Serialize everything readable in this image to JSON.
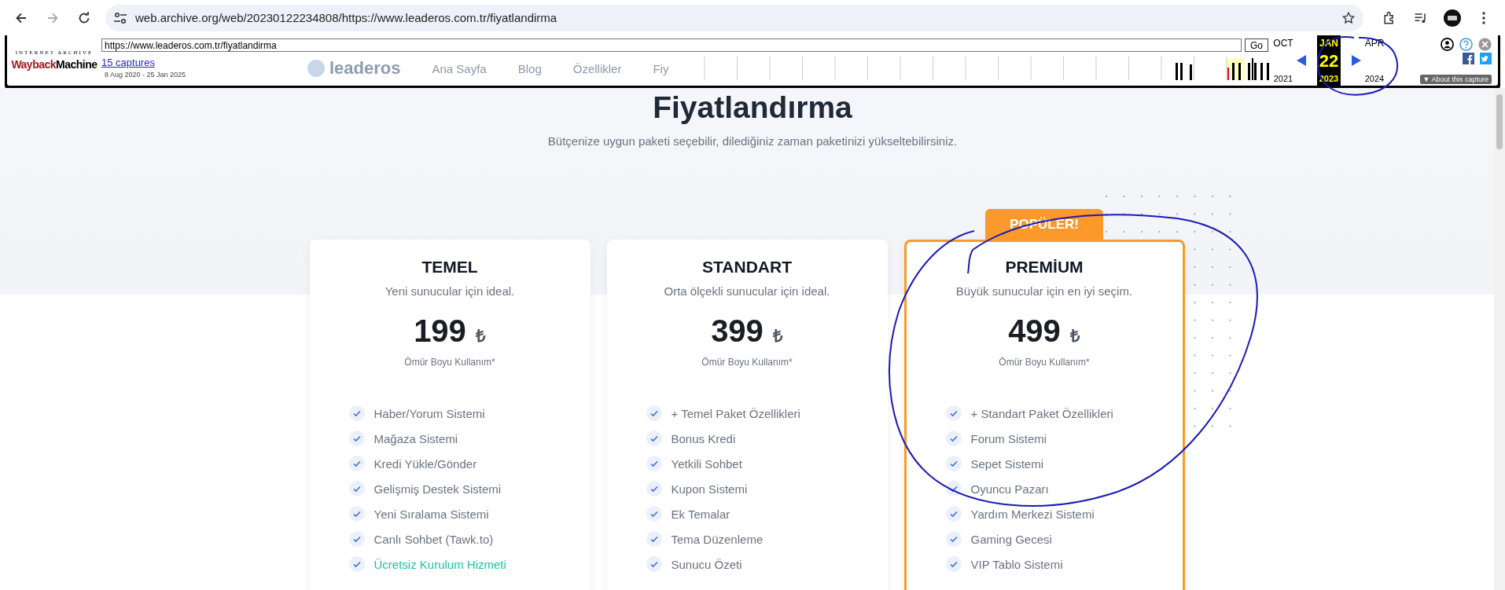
{
  "browser": {
    "url": "web.archive.org/web/20230122234808/https://www.leaderos.com.tr/fiyatlandirma",
    "forward_disabled": true
  },
  "wayback": {
    "logo_top": "INTERNET ARCHIVE",
    "logo_wayback": "Wayback",
    "logo_machine": "Machine",
    "url": "https://www.leaderos.com.tr/fiyatlandirma",
    "go": "Go",
    "captures": "15 captures",
    "date_range": "8 Aug 2020 - 25 Jan 2025",
    "months": [
      {
        "month": "OCT",
        "year": "2021",
        "selected": false
      },
      {
        "month": "JAN",
        "day": "22",
        "year": "2023",
        "selected": true
      },
      {
        "month": "APR",
        "year": "2024",
        "selected": false
      }
    ],
    "about_caret": "▼",
    "about": "About this capture"
  },
  "site_behind": {
    "logo": "leaderos",
    "nav": [
      "Ana Sayfa",
      "Blog",
      "Özellikler",
      "Fiy"
    ]
  },
  "page": {
    "title": "Fiyatlandırma",
    "subtitle": "Bütçenize uygun paketi seçebilir, dilediğiniz zaman paketinizi yükseltebilirsiniz."
  },
  "plans": [
    {
      "name": "TEMEL",
      "tagline": "Yeni sunucular için ideal.",
      "price": "199",
      "currency": "₺",
      "note": "Ömür Boyu Kullanım*",
      "popular": false,
      "features": [
        {
          "text": "Haber/Yorum Sistemi",
          "highlighted": false
        },
        {
          "text": "Mağaza Sistemi",
          "highlighted": false
        },
        {
          "text": "Kredi Yükle/Gönder",
          "highlighted": false
        },
        {
          "text": "Gelişmiş Destek Sistemi",
          "highlighted": false
        },
        {
          "text": "Yeni Sıralama Sistemi",
          "highlighted": false
        },
        {
          "text": "Canlı Sohbet (Tawk.to)",
          "highlighted": false
        },
        {
          "text": "Ücretsiz Kurulum Hizmeti",
          "highlighted": true
        }
      ]
    },
    {
      "name": "STANDART",
      "tagline": "Orta ölçekli sunucular için ideal.",
      "price": "399",
      "currency": "₺",
      "note": "Ömür Boyu Kullanım*",
      "popular": false,
      "features": [
        {
          "text": "+ Temel Paket Özellikleri",
          "highlighted": false
        },
        {
          "text": "Bonus Kredi",
          "highlighted": false
        },
        {
          "text": "Yetkili Sohbet",
          "highlighted": false
        },
        {
          "text": "Kupon Sistemi",
          "highlighted": false
        },
        {
          "text": "Ek Temalar",
          "highlighted": false
        },
        {
          "text": "Tema Düzenleme",
          "highlighted": false
        },
        {
          "text": "Sunucu Özeti",
          "highlighted": false
        }
      ]
    },
    {
      "name": "PREMİUM",
      "tagline": "Büyük sunucular için en iyi seçim.",
      "price": "499",
      "currency": "₺",
      "note": "Ömür Boyu Kullanım*",
      "popular": true,
      "badge": "POPÜLER!",
      "features": [
        {
          "text": "+ Standart Paket Özellikleri",
          "highlighted": false
        },
        {
          "text": "Forum Sistemi",
          "highlighted": false
        },
        {
          "text": "Sepet Sistemi",
          "highlighted": false
        },
        {
          "text": "Oyuncu Pazarı",
          "highlighted": false
        },
        {
          "text": "Yardım Merkezi Sistemi",
          "highlighted": false
        },
        {
          "text": "Gaming Gecesi",
          "highlighted": false
        },
        {
          "text": "VIP Tablo Sistemi",
          "highlighted": false
        }
      ]
    }
  ]
}
